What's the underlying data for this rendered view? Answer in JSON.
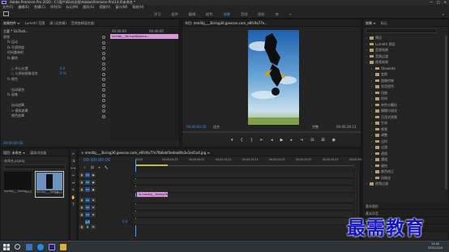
{
  "title_bar": {
    "title": "Adobe Premiere Pro 2020 - C:\\用户\\Kiko\\文档\\Adobe\\Premiere Pro\\14.0\\未命名 *",
    "controls": [
      "—",
      "□",
      "✕"
    ]
  },
  "menu": [
    "文件(F)",
    "编辑(E)",
    "剪辑(C)",
    "序列(S)",
    "标记(M)",
    "图形(G)",
    "视图(V)",
    "窗口(W)",
    "帮助(H)"
  ],
  "workspaces": {
    "tabs": [
      "学习",
      "组件",
      "编辑",
      "颜色",
      "效果",
      "音频",
      "图形",
      "库"
    ],
    "active": "效果",
    "more": "»"
  },
  "effect_controls": {
    "tabs": [
      "效果控件 ≡",
      "Lumetri 范围",
      "源:(无剪辑)",
      "音频剪辑混合器:"
    ],
    "clip_label": "主要 * 1b7bcb...",
    "rows": [
      {
        "label": "视频",
        "value": "",
        "indent": 0
      },
      {
        "label": "fx 运动",
        "value": "",
        "indent": 1
      },
      {
        "label": "fx 不透明度",
        "value": "",
        "indent": 1
      },
      {
        "label": "时间重映射",
        "value": "",
        "indent": 1
      },
      {
        "label": "fx 翻转",
        "value": "",
        "indent": 1
      },
      {
        "label": "",
        "value": "",
        "indent": 2
      },
      {
        "label": "○ 中心位置",
        "value": "0.0",
        "indent": 2
      },
      {
        "label": "○ 与原始图像混合",
        "value": "0 %",
        "indent": 2
      },
      {
        "label": "fx 颜色",
        "value": "",
        "indent": 1
      },
      {
        "label": "",
        "value": "",
        "indent": 2
      },
      {
        "label": "自动填充",
        "value": "",
        "indent": 2
      },
      {
        "label": "fx 画笔",
        "value": "",
        "indent": 1
      },
      {
        "label": "",
        "value": "",
        "indent": 2
      },
      {
        "label": "自动遮罩",
        "value": "",
        "indent": 2
      },
      {
        "label": "> 模拟遮罩",
        "value": "",
        "indent": 2
      },
      {
        "label": "颜色遮罩",
        "value": "",
        "indent": 2
      }
    ],
    "mini_time_start": "00:00:00",
    "mini_time_end": "00:00:05",
    "mini_clip": "mm4bj__3bring36jpexco...",
    "timecode": "00:00:00:00"
  },
  "program": {
    "tab": "节目: mm4bj___3bring36.jpexcon.com_e6fc9a77e...",
    "timecode": "00:00:00:00",
    "fit": "适合",
    "quality": "完整",
    "duration": "00:00:28:13"
  },
  "project": {
    "tabs": [
      "项目: 未命名 ≡",
      "媒体浏览器"
    ],
    "path": "未命名.prproj",
    "search_placeholder": "",
    "items": [
      {
        "name": "mm4bj___3bring...",
        "duration": "5:13"
      },
      {
        "name": "mm4bj___3bring...",
        "duration": "28:13"
      }
    ]
  },
  "timeline": {
    "tab": "× mm4bj___3bring36.jpexcon.com_e6fc9a77e7fb6ebf3e4ea8fa3e1e41a4.jpg ≡",
    "timecode": "00:00:00:00",
    "ruler": [
      "00:00",
      "00:00:04:23",
      "00:00:09:23",
      "00:00:14:23",
      "00:00:19:23",
      "00:00:24:23",
      "00:00:29:23",
      "00:00:34:23",
      "00:00:39:23"
    ],
    "tracks": [
      "V3",
      "V2",
      "V1",
      "A1",
      "A2",
      "A3",
      "主声道"
    ],
    "clip_label": "fx mm4bj__3bring36.jpexcon",
    "master_value": "0.0"
  },
  "effects_panel": {
    "tabs": [
      "效果 ≡",
      "标记"
    ],
    "items": [
      {
        "label": "预设",
        "type": "folder",
        "indent": 0
      },
      {
        "label": "Lumetri 预设",
        "type": "folder",
        "indent": 0
      },
      {
        "label": "音频效果",
        "type": "folder",
        "indent": 0
      },
      {
        "label": "音频过渡",
        "type": "folder",
        "indent": 0
      },
      {
        "label": "视频效果",
        "type": "folder",
        "indent": 0
      },
      {
        "label": "Obsolete",
        "type": "folder",
        "indent": 1
      },
      {
        "label": "变换",
        "type": "folder",
        "indent": 1
      },
      {
        "label": "图像控制",
        "type": "folder",
        "indent": 1
      },
      {
        "label": "实用程序",
        "type": "folder",
        "indent": 1
      },
      {
        "label": "扭曲",
        "type": "folder",
        "indent": 1
      },
      {
        "label": "时间",
        "type": "folder",
        "indent": 1
      },
      {
        "label": "杂色与颗粒",
        "type": "folder",
        "indent": 1
      },
      {
        "label": "模糊与锐化",
        "type": "folder",
        "indent": 1
      },
      {
        "label": "沉浸式视频",
        "type": "folder",
        "indent": 1
      },
      {
        "label": "生成",
        "type": "folder",
        "indent": 1
      },
      {
        "label": "视频",
        "type": "folder",
        "indent": 1
      },
      {
        "label": "调整",
        "type": "folder",
        "indent": 1
      },
      {
        "label": "过时",
        "type": "folder",
        "indent": 1
      },
      {
        "label": "过渡",
        "type": "folder",
        "indent": 1
      },
      {
        "label": "透视",
        "type": "folder",
        "indent": 1
      },
      {
        "label": "通道",
        "type": "folder",
        "indent": 1
      },
      {
        "label": "键控",
        "type": "folder",
        "indent": 1
      },
      {
        "label": "颜色校正",
        "type": "folder",
        "indent": 1
      },
      {
        "label": "风格化",
        "type": "folder",
        "indent": 1
      },
      {
        "label": "视频过渡",
        "type": "folder",
        "indent": 0
      }
    ],
    "bottom_items": [
      "基本图形",
      "基本声音",
      "Lumetri 颜色",
      "库"
    ]
  },
  "taskbar": {
    "time": "11:02",
    "date": "2021/11/4"
  },
  "watermark": "最需教育",
  "colors": {
    "accent": "#4a9dff",
    "clip": "#d898d8",
    "timecode": "#3e8de8"
  }
}
